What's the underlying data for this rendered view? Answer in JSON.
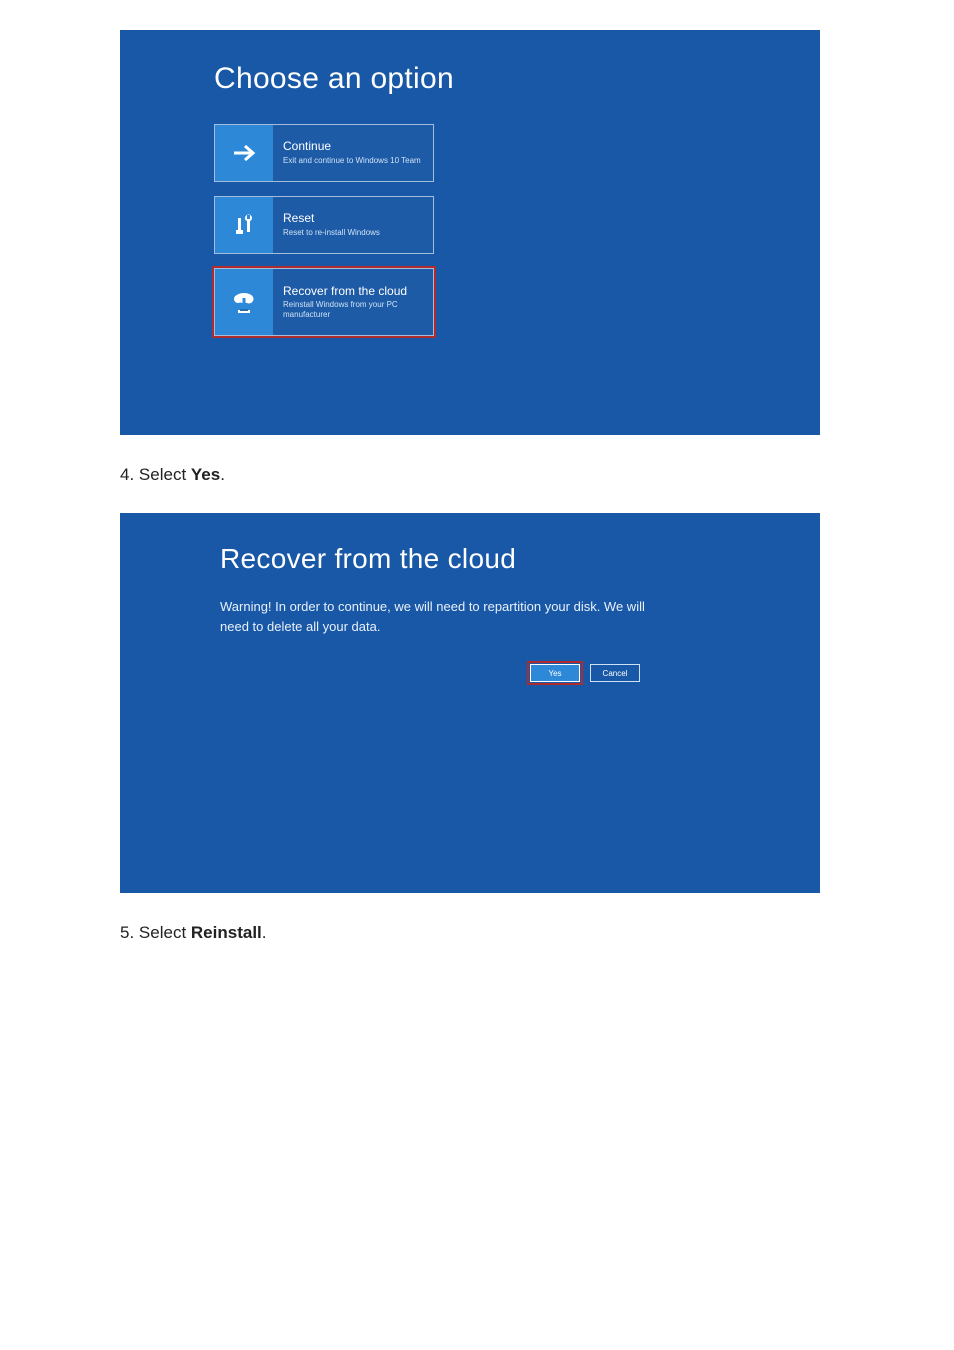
{
  "screen1": {
    "title": "Choose an option",
    "options": [
      {
        "title": "Continue",
        "sub": "Exit and continue to Windows 10 Team"
      },
      {
        "title": "Reset",
        "sub": "Reset to re-install Windows"
      },
      {
        "title": "Recover from the cloud",
        "sub": "Reinstall Windows from your PC manufacturer"
      }
    ]
  },
  "step4": {
    "num": "4.",
    "pre": "Select ",
    "bold": "Yes",
    "post": "."
  },
  "screen2": {
    "title": "Recover from the cloud",
    "warning": "Warning! In order to continue, we will need to repartition your disk. We will need to delete all your data.",
    "yes": "Yes",
    "cancel": "Cancel"
  },
  "step5": {
    "num": "5.",
    "pre": "Select ",
    "bold": "Reinstall",
    "post": "."
  }
}
